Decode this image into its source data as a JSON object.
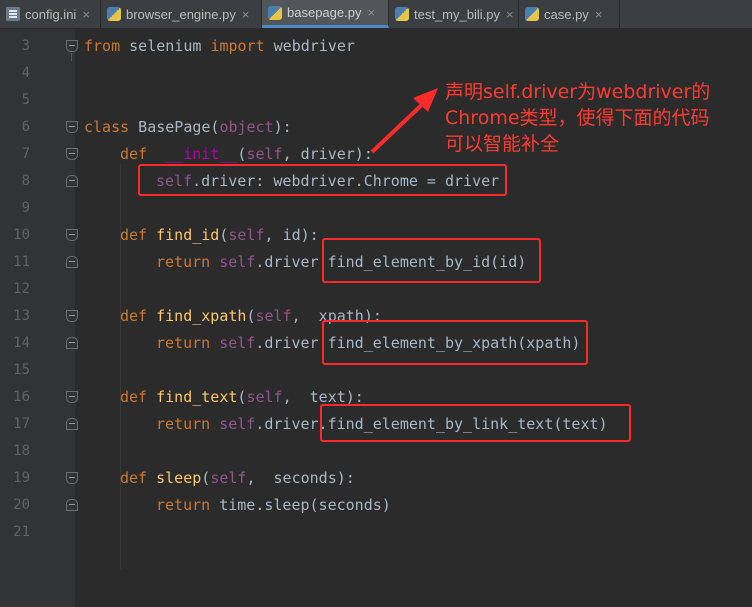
{
  "tabs": [
    {
      "label": "config.ini",
      "icon": "ini-file-icon",
      "active": false
    },
    {
      "label": "browser_engine.py",
      "icon": "python-file-icon",
      "active": false
    },
    {
      "label": "basepage.py",
      "icon": "python-file-icon",
      "active": true
    },
    {
      "label": "test_my_bili.py",
      "icon": "python-file-icon",
      "active": false
    },
    {
      "label": "case.py",
      "icon": "python-file-icon",
      "active": false
    }
  ],
  "close_glyph": "×",
  "line_numbers": [
    "3",
    "4",
    "5",
    "6",
    "7",
    "8",
    "9",
    "10",
    "11",
    "12",
    "13",
    "14",
    "15",
    "16",
    "17",
    "18",
    "19",
    "20",
    "21"
  ],
  "code": {
    "l3": {
      "k1": "from",
      "t1": " selenium ",
      "k2": "import",
      "t2": " webdriver"
    },
    "l6": {
      "k1": "class",
      "t1": " BasePage(",
      "t2": "object",
      "t3": "):"
    },
    "l7": {
      "k1": "def",
      "sp": "  ",
      "fn": "__init__",
      "t1": "(",
      "self": "self",
      "t2": ", driver):"
    },
    "l8": {
      "self": "self",
      "t1": ".driver: webdriver.Chrome = driver"
    },
    "l10": {
      "k1": "def",
      "fn": "find_id",
      "t1": "(",
      "self": "self",
      "t2": ", ",
      "p": "id",
      "t3": "):"
    },
    "l11": {
      "k1": "return",
      "self": "self",
      "t1": ".driver.",
      "t2": "find_element_by_id(id)"
    },
    "l13": {
      "k1": "def",
      "fn": "find_xpath",
      "t1": "(",
      "self": "self",
      "t2": ",  xpath):"
    },
    "l14": {
      "k1": "return",
      "self": "self",
      "t1": ".driver.",
      "t2": "find_element_by_xpath(xpath)"
    },
    "l16": {
      "k1": "def",
      "fn": "find_text",
      "t1": "(",
      "self": "self",
      "t2": ",  text):"
    },
    "l17": {
      "k1": "return",
      "self": "self",
      "t1": ".driver.",
      "t2": "find_element_by_link_text(text)"
    },
    "l19": {
      "k1": "def",
      "fn": "sleep",
      "t1": "(",
      "self": "self",
      "t2": ",  seconds):"
    },
    "l20": {
      "k1": "return",
      "t1": " time.sleep(seconds)"
    }
  },
  "annotation": {
    "line1": "声明self.driver为webdriver的",
    "line2": "Chrome类型，使得下面的代码",
    "line3": "可以智能补全"
  },
  "colors": {
    "keyword": "#cc7832",
    "self": "#94558d",
    "function": "#ffc66d",
    "annotation_red": "#ff2a2a",
    "background": "#2b2b2b"
  }
}
